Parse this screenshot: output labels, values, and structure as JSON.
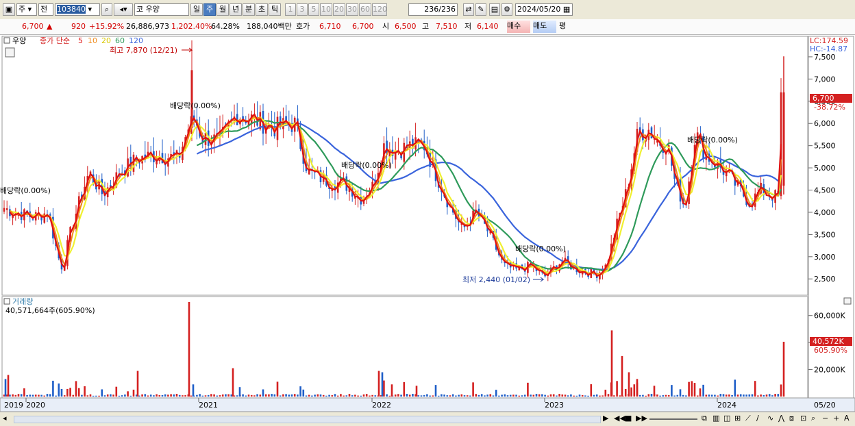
{
  "toolbar": {
    "market": "주",
    "period_type": "전",
    "code": "103840",
    "market_code": "코",
    "name": "우양",
    "periods": [
      "일",
      "주",
      "월",
      "년",
      "분",
      "초",
      "틱"
    ],
    "selected_period": "주",
    "nums": [
      "1",
      "3",
      "5",
      "10",
      "20",
      "30",
      "60",
      "120"
    ],
    "count": "236/236",
    "date": "2024/05/20"
  },
  "quote": {
    "price": "6,700",
    "change": "920",
    "change_pct": "+15.92%",
    "volume": "26,886,973",
    "volume_pct": "1,202.40%",
    "turnover": "64.28%",
    "amount": "188,040백만",
    "hoga_label": "호가",
    "ask": "6,710",
    "bid": "6,700",
    "open_label": "시",
    "open": "6,500",
    "high_label": "고",
    "high": "7,510",
    "low_label": "저",
    "low": "6,140",
    "buy_label": "매수",
    "sell_label": "매도",
    "eval_label": "평"
  },
  "price_panel": {
    "name_label": "우양",
    "ma_title": "종가 단순",
    "ma_periods": [
      "5",
      "10",
      "20",
      "60",
      "120"
    ],
    "lc_label": "LC:174.59",
    "hc_label": "HC:-14.87",
    "last_price_label": "6,700",
    "last_pct_label": "-38.72%",
    "high_marker": "최고 7,870 (12/21)",
    "low_marker": "최저 2,440 (01/02)",
    "dividend_markers": [
      "배당락(0.00%)",
      "배당락(0.00%)",
      "배당락(0.00%)",
      "배당락(0.00%)",
      "배당락(0.00%)"
    ]
  },
  "volume_panel": {
    "title": "거래량",
    "value_label": "40,571,664주(605.90%)",
    "last_label": "40,572K",
    "last_pct_label": "605.90%"
  },
  "date_labels": [
    "2019",
    "2020",
    "2021",
    "2022",
    "2023",
    "2024",
    "05/20"
  ],
  "colors": {
    "up": "#d42020",
    "down": "#1e5ec8",
    "ma5": "#e01010",
    "ma10": "#f08c1e",
    "ma20": "#f0f030",
    "ma60": "#2e9a5a",
    "ma120": "#3a64dc"
  },
  "chart_data": [
    {
      "type": "candlestick",
      "title": "우양",
      "x_range": [
        "2019-11",
        "2024-05-20"
      ],
      "y_ticks": [
        2500,
        3000,
        3500,
        4000,
        4500,
        5000,
        5500,
        6000,
        6500,
        7000,
        7500
      ],
      "ylim": [
        2180,
        7900
      ],
      "last_close": 6700,
      "annotations": [
        {
          "label": "최고 7,870 (12/21)",
          "value": 7870
        },
        {
          "label": "최저 2,440 (01/02)",
          "value": 2440
        }
      ],
      "close_path_by_period": [
        {
          "period": "2019",
          "close": 4100
        },
        {
          "period": "2020-03",
          "close": 2700
        },
        {
          "period": "2020-06",
          "close": 4900
        },
        {
          "period": "2020-12",
          "close": 6100
        },
        {
          "period": "2021-03",
          "close": 6100
        },
        {
          "period": "2021-06",
          "close": 5800
        },
        {
          "period": "2021-09",
          "close": 4800
        },
        {
          "period": "2021-12",
          "close": 4400
        },
        {
          "period": "2022-03",
          "close": 5500
        },
        {
          "period": "2022-06",
          "close": 5300
        },
        {
          "period": "2022-09",
          "close": 3900
        },
        {
          "period": "2022-12",
          "close": 2700
        },
        {
          "period": "2023-03",
          "close": 2800
        },
        {
          "period": "2023-06",
          "close": 2650
        },
        {
          "period": "2023-09",
          "close": 4200
        },
        {
          "period": "2023-12",
          "close": 5800
        },
        {
          "period": "2024-03",
          "close": 4500
        },
        {
          "period": "2024-05-20",
          "close": 6700
        }
      ],
      "series": [
        {
          "name": "5",
          "values": []
        },
        {
          "name": "10",
          "values": []
        },
        {
          "name": "20",
          "values": []
        },
        {
          "name": "60",
          "values": []
        },
        {
          "name": "120",
          "values": []
        }
      ]
    },
    {
      "type": "bar",
      "title": "거래량",
      "y_ticks": [
        "20,000K",
        "40,000K",
        "60,000K"
      ],
      "ylim": [
        0,
        70000
      ],
      "last_value_k": 40572,
      "peaks_k": [
        {
          "period": "2020-12",
          "value": 70000
        },
        {
          "period": "2021-02",
          "value": 21000
        },
        {
          "period": "2022-01",
          "value": 19000
        },
        {
          "period": "2023-06",
          "value": 49000
        },
        {
          "period": "2024-05-20",
          "value": 40572
        }
      ]
    }
  ]
}
